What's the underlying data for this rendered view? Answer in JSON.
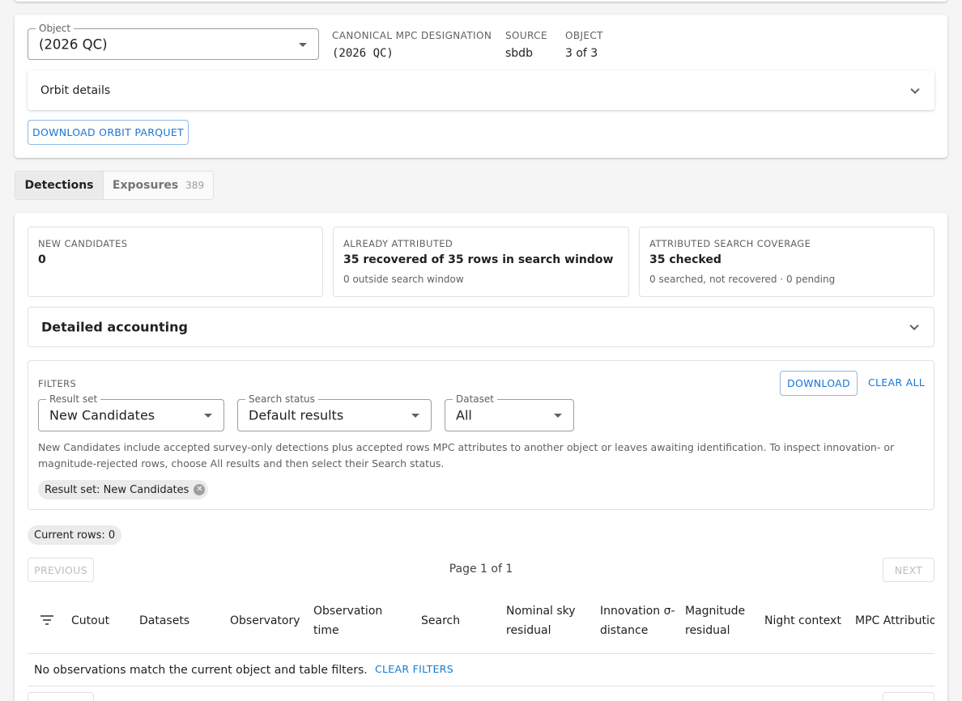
{
  "object_panel": {
    "object_select_label": "Object",
    "object_value": "(2026 QC)",
    "canonical_label": "CANONICAL MPC DESIGNATION",
    "canonical_value": "(2026 QC)",
    "source_label": "SOURCE",
    "source_value": "sbdb",
    "object_label": "OBJECT",
    "object_count": "3 of 3",
    "orbit_details_title": "Orbit details",
    "download_orbit_label": "DOWNLOAD ORBIT PARQUET"
  },
  "view_toggle": {
    "detections_label": "Detections",
    "exposures_label": "Exposures",
    "exposures_count": "389"
  },
  "summary": {
    "new_candidates_label": "NEW CANDIDATES",
    "new_candidates_value": "0",
    "already_attributed_label": "ALREADY ATTRIBUTED",
    "already_attributed_value": "35 recovered of 35 rows in search window",
    "already_attributed_sub": "0 outside search window",
    "coverage_label": "ATTRIBUTED SEARCH COVERAGE",
    "coverage_value": "35 checked",
    "coverage_sub": "0 searched, not recovered · 0 pending"
  },
  "detailed_accounting_title": "Detailed accounting",
  "filters": {
    "heading": "FILTERS",
    "download_label": "DOWNLOAD",
    "clear_all_label": "CLEAR ALL",
    "result_set_label": "Result set",
    "result_set_value": "New Candidates",
    "search_status_label": "Search status",
    "search_status_value": "Default results",
    "dataset_label": "Dataset",
    "dataset_value": "All",
    "help_text": "New Candidates include accepted survey-only detections plus accepted rows MPC attributes to another object or leaves awaiting identification. To inspect innovation- or magnitude-rejected rows, choose All results and then select their Search status.",
    "active_chip": "Result set: New Candidates"
  },
  "current_rows": "Current rows: 0",
  "pagination": {
    "previous_label": "PREVIOUS",
    "page_text": "Page 1 of 1",
    "next_label": "NEXT"
  },
  "table": {
    "columns": [
      "Cutout",
      "Datasets",
      "Observatory",
      "Observation time",
      "Search",
      "Nominal sky residual",
      "Innovation σ-distance",
      "Magnitude residual",
      "Night context",
      "MPC Attribution"
    ],
    "empty_message": "No observations match the current object and table filters.",
    "clear_filters_label": "CLEAR FILTERS"
  },
  "colors": {
    "accent": "#1976d2",
    "background": "#f5f5f5",
    "card": "#ffffff"
  },
  "icons": [
    "caret-down-icon",
    "chevron-down-icon",
    "filter-list-icon",
    "chip-cancel-icon"
  ]
}
